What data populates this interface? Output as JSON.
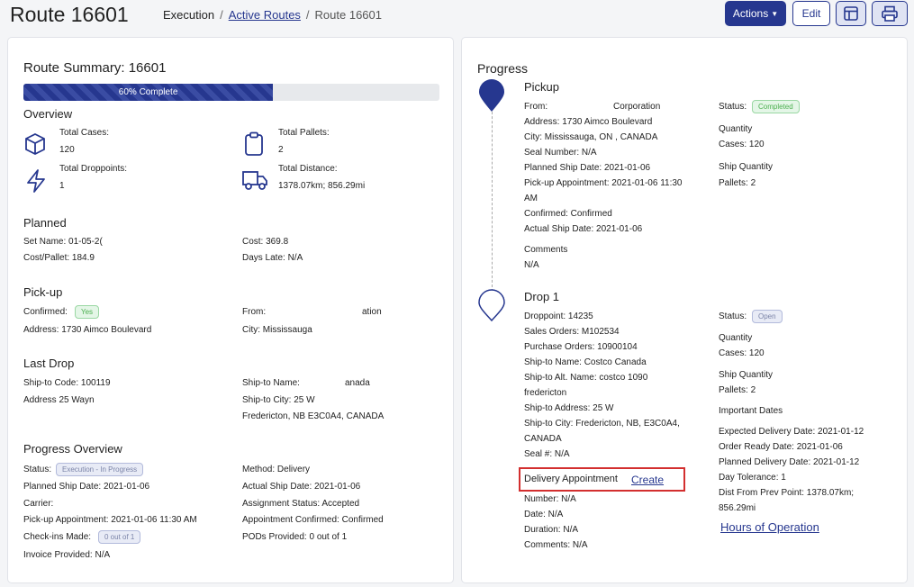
{
  "header": {
    "title": "Route 16601",
    "breadcrumb": {
      "root": "Execution",
      "link": "Active Routes",
      "current": "Route 16601"
    },
    "buttons": {
      "actions": "Actions",
      "edit": "Edit"
    }
  },
  "summary": {
    "title": "Route Summary: 16601",
    "progress_label": "60% Complete",
    "progress_percent": 60,
    "overview": {
      "heading": "Overview",
      "total_cases_label": "Total Cases:",
      "total_cases": "120",
      "total_pallets_label": "Total Pallets:",
      "total_pallets": "2",
      "total_droppoints_label": "Total Droppoints:",
      "total_droppoints": "1",
      "total_distance_label": "Total Distance:",
      "total_distance": "1378.07km; 856.29mi"
    },
    "planned": {
      "heading": "Planned",
      "set_name": "Set Name: 01-05-2(",
      "cost": "Cost: 369.8",
      "cost_pallet": "Cost/Pallet: 184.9",
      "days_late": "Days Late: N/A"
    },
    "pickup": {
      "heading": "Pick-up",
      "confirmed_label": "Confirmed:",
      "confirmed_badge": "Yes",
      "from_label": "From:",
      "from_value": "ation",
      "address": "Address: 1730 Aimco Boulevard",
      "city": "City: Mississauga"
    },
    "last_drop": {
      "heading": "Last Drop",
      "ship_to_code": "Ship-to Code: 100119",
      "ship_to_name_label": "Ship-to Name:",
      "ship_to_name_value": "anada",
      "address": "Address 25 Wayn",
      "ship_to_city": "Ship-to City: 25 W",
      "ship_to_city2": "Fredericton, NB E3C0A4, CANADA"
    },
    "progress_overview": {
      "heading": "Progress Overview",
      "status_label": "Status:",
      "status_badge": "Execution - In Progress",
      "method": "Method: Delivery",
      "planned_ship_date": "Planned Ship Date: 2021-01-06",
      "actual_ship_date": "Actual Ship Date: 2021-01-06",
      "carrier": "Carrier:",
      "assignment_status": "Assignment Status: Accepted",
      "pickup_appt": "Pick-up Appointment: 2021-01-06 11:30 AM",
      "appt_confirmed": "Appointment Confirmed: Confirmed",
      "checkins_label": "Check-ins Made:",
      "checkins_badge": "0 out of 1",
      "pods": "PODs Provided: 0 out of 1",
      "invoice": "Invoice Provided: N/A"
    }
  },
  "progress": {
    "title": "Progress",
    "pickup": {
      "heading": "Pickup",
      "from_label": "From:",
      "from_value": "Corporation",
      "address": "Address: 1730 Aimco Boulevard",
      "city": "City: Mississauga, ON , CANADA",
      "seal": "Seal Number: N/A",
      "planned_ship": "Planned Ship Date: 2021-01-06",
      "appt_line1": "Pick-up Appointment: 2021-01-06 11:30",
      "appt_line2": "AM",
      "confirmed": "Confirmed: Confirmed",
      "actual_ship": "Actual Ship Date: 2021-01-06",
      "comments_label": "Comments",
      "comments": "N/A",
      "status_label": "Status:",
      "status_badge": "Completed",
      "quantity_label": "Quantity",
      "cases": "Cases: 120",
      "ship_qty_label": "Ship Quantity",
      "pallets": "Pallets: 2"
    },
    "drop": {
      "heading": "Drop 1",
      "droppoint": "Droppoint: 14235",
      "sales_orders": "Sales Orders: M102534",
      "purchase_orders": "Purchase Orders: 10900104",
      "ship_to_name": "Ship-to Name: Costco Canada",
      "alt_name_line1": "Ship-to Alt. Name: costco 1090",
      "alt_name_line2": "fredericton",
      "ship_to_address": "Ship-to Address: 25 W",
      "ship_to_city_line1": "Ship-to City: Fredericton, NB, E3C0A4,",
      "ship_to_city_line2": "CANADA",
      "seal": "Seal #: N/A",
      "delivery_appt_label": "Delivery Appointment",
      "create_link": "Create",
      "number": "Number: N/A",
      "date": "Date: N/A",
      "duration": "Duration: N/A",
      "comments": "Comments: N/A",
      "status_label": "Status:",
      "status_badge": "Open",
      "quantity_label": "Quantity",
      "cases": "Cases: 120",
      "ship_qty_label": "Ship Quantity",
      "pallets": "Pallets: 2",
      "important_dates_label": "Important Dates",
      "expected_delivery": "Expected Delivery Date: 2021-01-12",
      "order_ready": "Order Ready Date: 2021-01-06",
      "planned_delivery": "Planned Delivery Date: 2021-01-12",
      "day_tolerance": "Day Tolerance: 1",
      "dist_line1": "Dist From Prev Point: 1378.07km;",
      "dist_line2": "856.29mi",
      "hours_link": "Hours of Operation"
    }
  },
  "colors": {
    "primary": "#26378f",
    "highlight_box": "#d32f2f",
    "completed_badge": "#4caf50"
  }
}
